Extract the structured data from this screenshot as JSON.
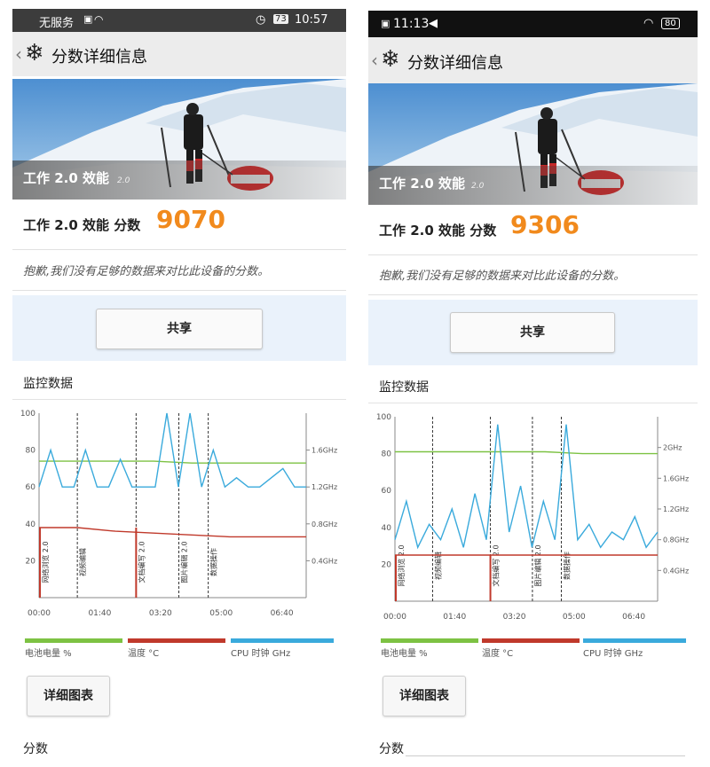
{
  "phones": [
    {
      "status": {
        "carrier": "无服务",
        "battery": "73",
        "time": "10:57"
      },
      "header": {
        "title": "分数详细信息"
      },
      "hero": {
        "overlay_title": "工作 2.0 效能",
        "overlay_version": "2.0"
      },
      "score": {
        "label": "工作 2.0 效能 分数",
        "value": "9070"
      },
      "notice": "抱歉,我们没有足够的数据来对比此设备的分数。",
      "share_label": "共享",
      "monitor": {
        "title": "监控数据"
      },
      "chart_data": {
        "type": "line",
        "x_ticks": [
          "00:00",
          "01:40",
          "03:20",
          "05:00",
          "06:40"
        ],
        "y_left_ticks": [
          "100",
          "80",
          "60",
          "40",
          "20"
        ],
        "y_right_ticks": [
          "1.6GHz",
          "1.2GHz",
          "0.8GHz",
          "0.4GHz"
        ],
        "ylim": [
          0,
          100
        ],
        "cpu_range_ghz": [
          0,
          2.0
        ],
        "segments": [
          "网络浏览 2.0",
          "视频编辑",
          "文档编写 2.0",
          "图片编辑 2.0",
          "数据操作"
        ],
        "battery_percent": [
          74,
          74,
          74,
          74,
          73,
          73,
          73,
          73
        ],
        "temperature_c": [
          38,
          38,
          36,
          35,
          34,
          33,
          33,
          33
        ],
        "cpu_ghz": [
          1.2,
          1.6,
          1.2,
          1.2,
          1.6,
          1.2,
          1.2,
          1.5,
          1.2,
          1.2,
          1.2,
          2.0,
          1.2,
          2.0,
          1.2,
          1.6,
          1.2,
          1.3,
          1.2,
          1.2,
          1.3,
          1.4,
          1.2,
          1.2
        ]
      },
      "legend": {
        "battery": "电池电量 %",
        "temp": "温度 °C",
        "cpu": "CPU 时钟 GHz"
      },
      "colors": {
        "battery": "#7dc243",
        "temp": "#c0392b",
        "cpu": "#3aaadc",
        "score": "#f18a1d"
      },
      "detail_label": "详细图表",
      "bottom_label": "分数"
    },
    {
      "status": {
        "time": "11:13",
        "battery": "80"
      },
      "header": {
        "title": "分数详细信息"
      },
      "hero": {
        "overlay_title": "工作 2.0 效能",
        "overlay_version": "2.0"
      },
      "score": {
        "label": "工作 2.0 效能 分数",
        "value": "9306"
      },
      "notice": "抱歉,我们没有足够的数据来对比此设备的分数。",
      "share_label": "共享",
      "monitor": {
        "title": "监控数据"
      },
      "chart_data": {
        "type": "line",
        "x_ticks": [
          "00:00",
          "01:40",
          "03:20",
          "05:00",
          "06:40"
        ],
        "y_left_ticks": [
          "100",
          "80",
          "60",
          "40",
          "20"
        ],
        "y_right_ticks": [
          "2GHz",
          "1.6GHz",
          "1.2GHz",
          "0.8GHz",
          "0.4GHz"
        ],
        "ylim": [
          0,
          100
        ],
        "cpu_range_ghz": [
          0,
          2.4
        ],
        "segments": [
          "网络浏览 2.0",
          "视频编辑",
          "文档编写 2.0",
          "图片编辑 2.0",
          "数据操作"
        ],
        "battery_percent": [
          81,
          81,
          81,
          81,
          81,
          80,
          80,
          80
        ],
        "temperature_c": [
          25,
          25,
          25,
          25,
          25,
          25,
          25,
          25
        ],
        "cpu_ghz": [
          0.8,
          1.3,
          0.7,
          1.0,
          0.8,
          1.2,
          0.7,
          1.4,
          0.8,
          2.3,
          0.9,
          1.5,
          0.7,
          1.3,
          0.8,
          2.3,
          0.8,
          1.0,
          0.7,
          0.9,
          0.8,
          1.1,
          0.7,
          0.9
        ]
      },
      "legend": {
        "battery": "电池电量 %",
        "temp": "温度 °C",
        "cpu": "CPU 时钟 GHz"
      },
      "colors": {
        "battery": "#7dc243",
        "temp": "#c0392b",
        "cpu": "#3aaadc",
        "score": "#f18a1d"
      },
      "detail_label": "详细图表",
      "bottom_label": "分数"
    }
  ]
}
